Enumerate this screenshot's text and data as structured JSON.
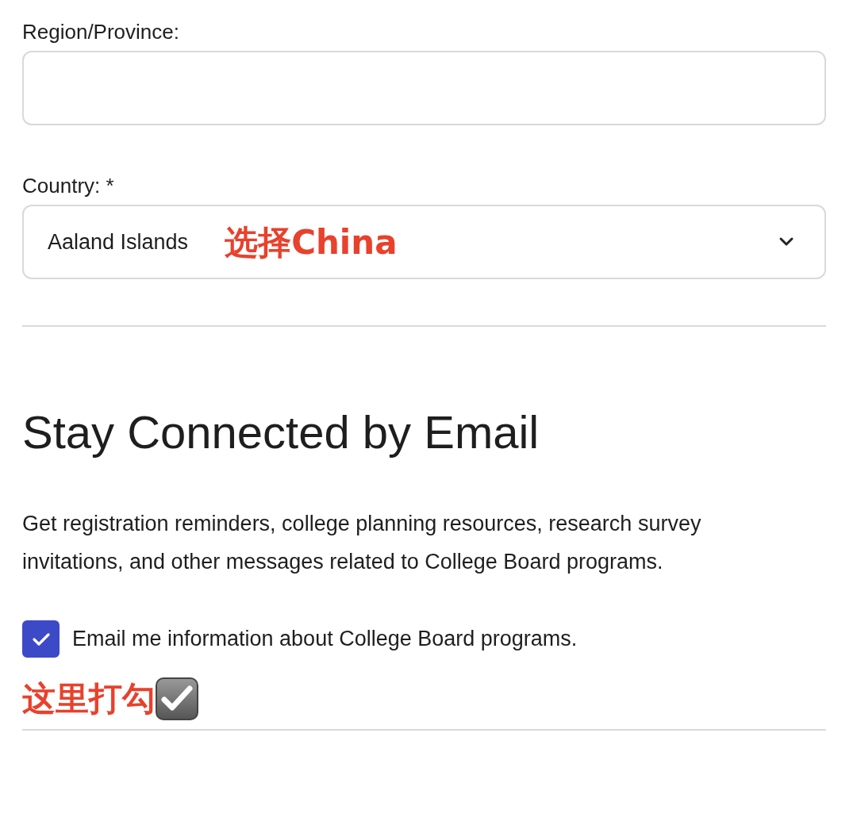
{
  "fields": [
    {
      "kind": "text",
      "label": "Region/Province:"
    },
    {
      "kind": "select",
      "label": "Country: *",
      "value": "Aaland Islands",
      "annotation": "选择China"
    }
  ],
  "section": {
    "title": "Stay Connected by Email",
    "description": "Get registration reminders, college planning resources, research survey invitations, and other messages related to College Board programs.",
    "checkbox": {
      "label": "Email me information about College Board programs.",
      "checked": true
    },
    "annotation": "这里打勾"
  }
}
